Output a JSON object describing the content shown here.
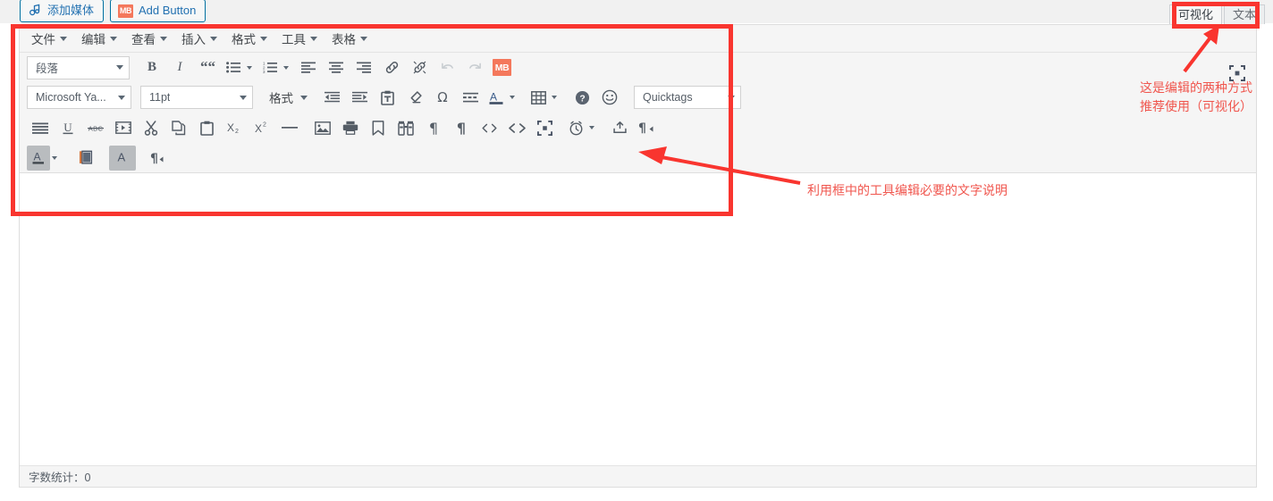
{
  "topbar": {
    "add_media_label": "添加媒体",
    "add_media_icon": "media-icon",
    "add_button_label": "Add Button",
    "add_button_badge": "MB"
  },
  "editor_tabs": [
    {
      "label": "可视化",
      "active": true
    },
    {
      "label": "文本",
      "active": false
    }
  ],
  "menubar": [
    {
      "label": "文件"
    },
    {
      "label": "编辑"
    },
    {
      "label": "查看"
    },
    {
      "label": "插入"
    },
    {
      "label": "格式"
    },
    {
      "label": "工具"
    },
    {
      "label": "表格"
    }
  ],
  "toolbar_row1": {
    "paragraph_select": "段落",
    "buttons": [
      {
        "name": "bold-button",
        "glyph": "B"
      },
      {
        "name": "italic-button",
        "glyph": "I"
      },
      {
        "name": "blockquote-button",
        "glyph": "“"
      },
      {
        "name": "bullet-list-button",
        "glyph": "bullist"
      },
      {
        "name": "numbered-list-button",
        "glyph": "numlist"
      },
      {
        "name": "align-left-button",
        "glyph": "alignleft"
      },
      {
        "name": "align-center-button",
        "glyph": "aligncenter"
      },
      {
        "name": "align-right-button",
        "glyph": "alignright"
      },
      {
        "name": "insert-link-button",
        "glyph": "link"
      },
      {
        "name": "unlink-button",
        "glyph": "unlink"
      },
      {
        "name": "undo-button",
        "glyph": "undo"
      },
      {
        "name": "redo-button",
        "glyph": "redo"
      }
    ],
    "mb_button_label": "MB"
  },
  "toolbar_row2": {
    "font_family_select": "Microsoft Ya...",
    "font_size_select": "11pt",
    "format_label": "格式",
    "quicktags_select": "Quicktags",
    "buttons": [
      {
        "name": "outdent-button"
      },
      {
        "name": "indent-button"
      },
      {
        "name": "paste-as-text-button"
      },
      {
        "name": "clear-formatting-button"
      },
      {
        "name": "special-character-button",
        "glyph": "Ω"
      },
      {
        "name": "read-more-button"
      },
      {
        "name": "text-color-button",
        "glyph": "A"
      },
      {
        "name": "insert-table-button"
      },
      {
        "name": "keyboard-shortcuts-button",
        "glyph": "?"
      },
      {
        "name": "emoji-button",
        "glyph": "☺"
      }
    ]
  },
  "toolbar_row3": {
    "buttons": [
      {
        "name": "justify-button"
      },
      {
        "name": "underline-button",
        "glyph": "U"
      },
      {
        "name": "strikethrough-button",
        "glyph": "ABC"
      },
      {
        "name": "insert-video-button"
      },
      {
        "name": "cut-button"
      },
      {
        "name": "copy-button"
      },
      {
        "name": "paste-button"
      },
      {
        "name": "subscript-button",
        "glyph": "X₂"
      },
      {
        "name": "superscript-button",
        "glyph": "X²"
      },
      {
        "name": "horizontal-rule-button"
      },
      {
        "name": "insert-image-button"
      },
      {
        "name": "print-button"
      },
      {
        "name": "anchor-button"
      },
      {
        "name": "find-replace-button"
      },
      {
        "name": "show-blocks-button",
        "glyph": "¶"
      },
      {
        "name": "paragraph-mark-button",
        "glyph": "¶"
      },
      {
        "name": "inline-code-button",
        "glyph": "<>"
      },
      {
        "name": "source-code-button",
        "glyph": "<>"
      },
      {
        "name": "fullscreen-button"
      },
      {
        "name": "insert-datetime-button"
      },
      {
        "name": "insert-template-button"
      },
      {
        "name": "ltr-direction-button",
        "glyph": "¶"
      }
    ]
  },
  "toolbar_row4": {
    "buttons": [
      {
        "name": "text-color-button",
        "glyph": "A"
      },
      {
        "name": "page-break-button"
      },
      {
        "name": "background-color-button",
        "glyph": "A"
      },
      {
        "name": "rtl-direction-button",
        "glyph": "¶"
      }
    ]
  },
  "editor_body": {
    "content": "",
    "fullscreen_icon": "fullscreen-icon"
  },
  "statusbar": {
    "word_count": "字数统计：0"
  },
  "annotations": [
    {
      "name": "annotation-toolbar-note",
      "text": "利用框中的工具编辑必要的文字说明"
    },
    {
      "name": "annotation-tabs-note",
      "text": "这是编辑的两种方式推荐使用（可视化）"
    }
  ],
  "colors": {
    "annotation_red": "#f9352f",
    "annotation_text": "#f0564e",
    "wp_blue": "#2271b1",
    "mb_orange": "#f4785c",
    "toolbar_bg": "#f5f5f5"
  }
}
